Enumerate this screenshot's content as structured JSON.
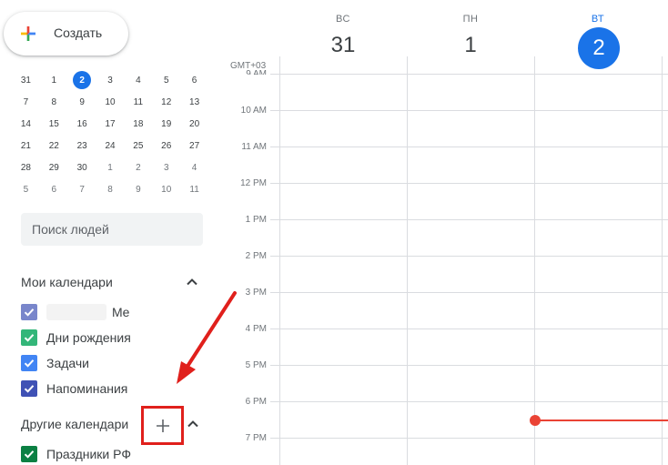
{
  "create": {
    "label": "Создать",
    "icon": "plus-multicolor-icon"
  },
  "mini_calendar": {
    "weeks": [
      [
        "31",
        "1",
        "2",
        "3",
        "4",
        "5",
        "6"
      ],
      [
        "7",
        "8",
        "9",
        "10",
        "11",
        "12",
        "13"
      ],
      [
        "14",
        "15",
        "16",
        "17",
        "18",
        "19",
        "20"
      ],
      [
        "21",
        "22",
        "23",
        "24",
        "25",
        "26",
        "27"
      ],
      [
        "28",
        "29",
        "30",
        "1",
        "2",
        "3",
        "4"
      ],
      [
        "5",
        "6",
        "7",
        "8",
        "9",
        "10",
        "11"
      ]
    ],
    "today": "2"
  },
  "search_people": {
    "placeholder": "Поиск людей"
  },
  "my_calendars": {
    "title": "Мои календари",
    "items": [
      {
        "label": "Me",
        "color": "#7986cb"
      },
      {
        "label": "Дни рождения",
        "color": "#33b679"
      },
      {
        "label": "Задачи",
        "color": "#4285f4"
      },
      {
        "label": "Напоминания",
        "color": "#3f51b5"
      }
    ]
  },
  "other_calendars": {
    "title": "Другие календари",
    "add_icon": "plus-icon",
    "items": [
      {
        "label": "Праздники РФ",
        "color": "#0b8043"
      }
    ]
  },
  "grid": {
    "timezone": "GMT+03",
    "days": [
      {
        "dow": "ВС",
        "date": "31"
      },
      {
        "dow": "ПН",
        "date": "1"
      },
      {
        "dow": "ВТ",
        "date": "2",
        "active": true
      }
    ],
    "times": [
      "9 AM",
      "10 AM",
      "11 AM",
      "12 PM",
      "1 PM",
      "2 PM",
      "3 PM",
      "4 PM",
      "5 PM",
      "6 PM",
      "7 PM"
    ]
  },
  "colors": {
    "accent": "#1a73e8",
    "now": "#ea4335",
    "annotation": "#e0201c"
  }
}
